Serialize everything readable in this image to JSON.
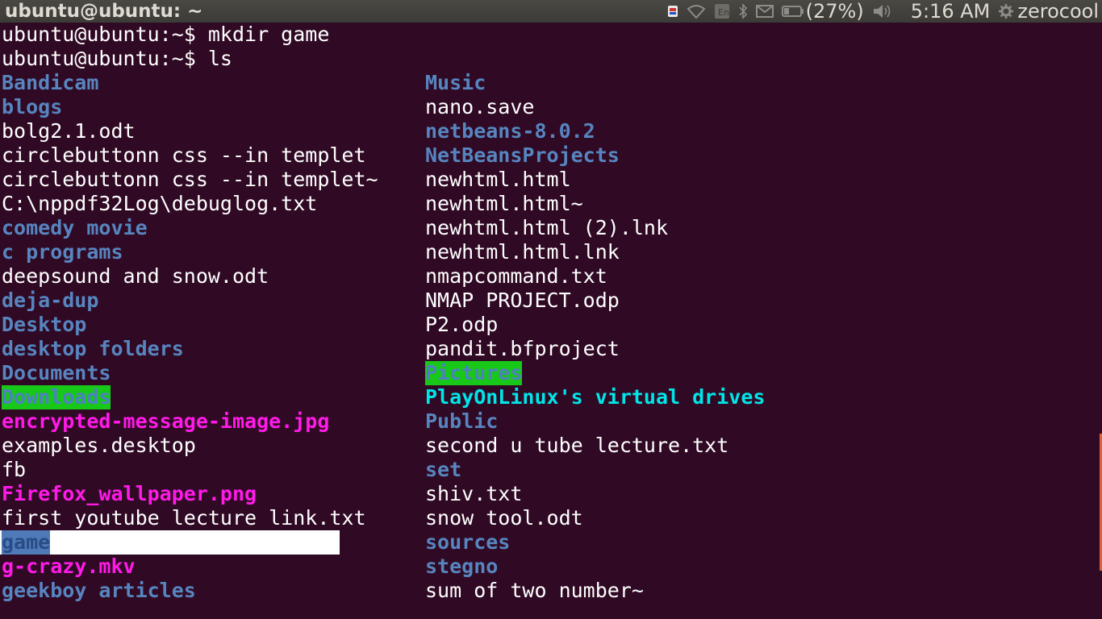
{
  "panel": {
    "window_title": "ubuntu@ubuntu: ~",
    "battery_percent": "(27%)",
    "clock": "5:16 AM",
    "user": "zerocool",
    "icons": [
      "dropbox-icon",
      "wifi-icon",
      "keyboard-icon",
      "bluetooth-icon",
      "mail-icon",
      "battery-icon",
      "volume-icon",
      "gear-icon"
    ]
  },
  "terminal": {
    "colors": {
      "background": "#300a24",
      "directory": "#5785c0",
      "file": "#ffffff",
      "image_media": "#ff1ae8",
      "other_writable_dir": "#00e5e8",
      "sticky_highlight_bg": "#18c818"
    },
    "lines": {
      "prompt1": "ubuntu@ubuntu:~$ mkdir game",
      "prompt2": "ubuntu@ubuntu:~$ ls"
    },
    "col1": [
      {
        "name": "Bandicam"
      },
      {
        "name": "blogs"
      },
      {
        "name": "bolg2.1.odt"
      },
      {
        "name": "circlebuttonn css --in templet"
      },
      {
        "name": "circlebuttonn css --in templet~"
      },
      {
        "name": "C:\\nppdf32Log\\debuglog.txt"
      },
      {
        "name": "comedy movie"
      },
      {
        "name": "c programs"
      },
      {
        "name": "deepsound and snow.odt"
      },
      {
        "name": "deja-dup"
      },
      {
        "name": "Desktop"
      },
      {
        "name": "desktop folders"
      },
      {
        "name": "Documents"
      },
      {
        "name": "Downloads"
      },
      {
        "name": "encrypted-message-image.jpg"
      },
      {
        "name": "examples.desktop"
      },
      {
        "name": "fb"
      },
      {
        "name": "Firefox_wallpaper.png"
      },
      {
        "name": "first youtube lecture link.txt"
      },
      {
        "name": "game"
      },
      {
        "name": "g-crazy.mkv"
      },
      {
        "name": "geekboy articles"
      }
    ],
    "col2": [
      {
        "name": "Music"
      },
      {
        "name": "nano.save"
      },
      {
        "name": "netbeans-8.0.2"
      },
      {
        "name": "NetBeansProjects"
      },
      {
        "name": "newhtml.html"
      },
      {
        "name": "newhtml.html~"
      },
      {
        "name": "newhtml.html (2).lnk"
      },
      {
        "name": "newhtml.html.lnk"
      },
      {
        "name": "nmapcommand.txt"
      },
      {
        "name": "NMAP PROJECT.odp"
      },
      {
        "name": "P2.odp"
      },
      {
        "name": "pandit.bfproject"
      },
      {
        "name": "Pictures"
      },
      {
        "name": "PlayOnLinux's virtual drives"
      },
      {
        "name": "Public"
      },
      {
        "name": "second u tube lecture.txt"
      },
      {
        "name": "set"
      },
      {
        "name": "shiv.txt"
      },
      {
        "name": "snow tool.odt"
      },
      {
        "name": "sources"
      },
      {
        "name": "stegno"
      },
      {
        "name": "sum of two number~"
      }
    ]
  }
}
